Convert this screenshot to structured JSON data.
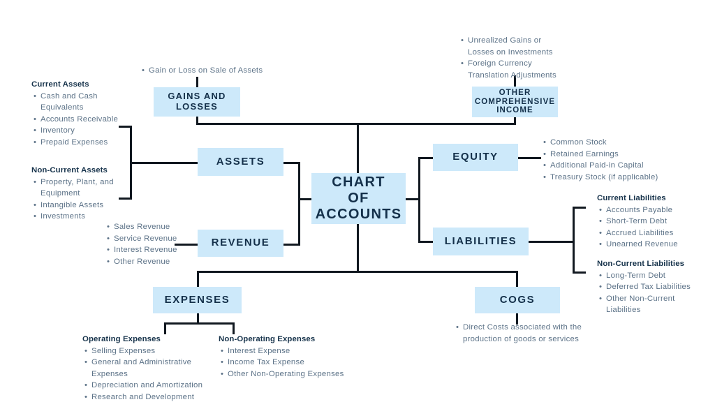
{
  "diagram": {
    "title": "Chart of Accounts",
    "colors": {
      "box_fill": "#cde9fa",
      "box_text": "#14304a",
      "connector": "#111820",
      "list_text": "#5d7388",
      "heading_text": "#18344c",
      "background": "#ffffff"
    },
    "nodes": {
      "center": {
        "line1": "CHART",
        "line2": "OF",
        "line3": "ACCOUNTS"
      },
      "gains_and_losses": {
        "line1": "GAINS AND",
        "line2": "LOSSES"
      },
      "other_comprehensive_income": {
        "line1": "OTHER",
        "line2": "COMPREHENSIVE",
        "line3": "INCOME"
      },
      "assets": {
        "label": "ASSETS"
      },
      "revenue": {
        "label": "REVENUE"
      },
      "equity": {
        "label": "EQUITY"
      },
      "liabilities": {
        "label": "LIABILITIES"
      },
      "expenses": {
        "label": "EXPENSES"
      },
      "cogs": {
        "label": "COGS"
      }
    },
    "lists": {
      "gains_losses_items": [
        "Gain or Loss on Sale of Assets"
      ],
      "oci_items": [
        "Unrealized Gains or Losses on Investments",
        "Foreign Currency Translation Adjustments"
      ],
      "current_assets": {
        "heading": "Current Assets",
        "items": [
          "Cash and Cash Equivalents",
          "Accounts Receivable",
          "Inventory",
          "Prepaid Expenses"
        ]
      },
      "non_current_assets": {
        "heading": "Non-Current Assets",
        "items": [
          "Property, Plant, and Equipment",
          "Intangible Assets",
          "Investments"
        ]
      },
      "revenue_items": [
        "Sales Revenue",
        "Service Revenue",
        "Interest Revenue",
        "Other Revenue"
      ],
      "equity_items": [
        "Common Stock",
        "Retained Earnings",
        "Additional Paid-in Capital",
        "Treasury Stock (if applicable)"
      ],
      "current_liabilities": {
        "heading": "Current Liabilities",
        "items": [
          "Accounts Payable",
          "Short-Term Debt",
          "Accrued Liabilities",
          "Unearned Revenue"
        ]
      },
      "non_current_liabilities": {
        "heading": "Non-Current Liabilities",
        "items": [
          "Long-Term Debt",
          "Deferred Tax Liabilities",
          "Other Non-Current Liabilities"
        ]
      },
      "operating_expenses": {
        "heading": "Operating Expenses",
        "items": [
          "Selling Expenses",
          "General and Administrative Expenses",
          "Depreciation and Amortization",
          "Research and Development"
        ]
      },
      "non_operating_expenses": {
        "heading": "Non-Operating Expenses",
        "items": [
          "Interest Expense",
          "Income Tax Expense",
          "Other Non-Operating Expenses"
        ]
      },
      "cogs_items": [
        "Direct Costs associated with the production of goods or services"
      ]
    }
  }
}
